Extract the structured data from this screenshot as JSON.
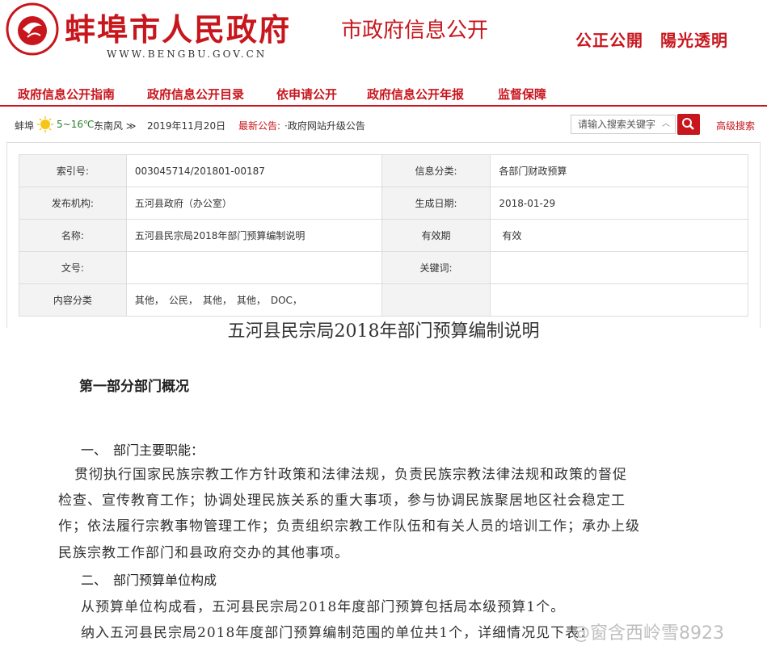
{
  "header": {
    "site_name": "蚌埠市人民政府",
    "site_url": "WWW.BENGBU.GOV.CN",
    "section_title": "市政府信息公开",
    "slogan": "公正公開　陽光透明",
    "logo_label": "中国蚌埠 BENGBU CHINA",
    "brand_color": "#c8161d"
  },
  "nav": {
    "items": [
      "政府信息公开指南",
      "政府信息公开目录",
      "依申请公开",
      "政府信息公开年报",
      "监督保障"
    ]
  },
  "info_bar": {
    "city": "蚌埠",
    "weather_icon": "sun-icon",
    "temperature": "5~16℃",
    "wind": "东南风 ≫",
    "date": "2019年11月20日",
    "latest_label": "最新公告:",
    "latest_text": "·政府网站升级公告",
    "search_placeholder": "请输入搜索关键字",
    "search_icon": "search-icon",
    "advanced_search": "高级搜索"
  },
  "meta": {
    "rows": [
      {
        "l1": "索引号:",
        "v1": "003045714/201801-00187",
        "l2": "信息分类:",
        "v2": "各部门财政预算"
      },
      {
        "l1": "发布机构:",
        "v1": "五河县政府（办公室）",
        "l2": "生成日期:",
        "v2": "2018-01-29"
      },
      {
        "l1": "名称:",
        "v1": "五河县民宗局2018年部门预算编制说明",
        "l2": "有效期",
        "v2": "有效"
      },
      {
        "l1": "文号:",
        "v1": "",
        "l2": "关键词:",
        "v2": ""
      },
      {
        "l1": "内容分类",
        "v1": "其他，　公民，　其他，　其他，　DOC，",
        "l2": "",
        "v2": ""
      }
    ]
  },
  "article": {
    "title": "五河县民宗局2018年部门预算编制说明",
    "part1_heading": "第一部分部门概况",
    "sub1": "一、　部门主要职能：",
    "para1_lines": [
      "贯彻执行国家民族宗教工作方针政策和法律法规，负责民族宗教法律法规和政策的督促",
      "检查、宣传教育工作；协调处理民族关系的重大事项，参与协调民族聚居地区社会稳定工",
      "作；依法履行宗教事物管理工作；负责组织宗教工作队伍和有关人员的培训工作；承办上级",
      "民族宗教工作部门和县政府交办的其他事项。"
    ],
    "sub2": "二、　部门预算单位构成",
    "para2_lines": [
      "从预算单位构成看，五河县民宗局2018年度部门预算包括局本级预算1个。",
      "纳入五河县民宗局2018年度部门预算编制范围的单位共1个，详细情况见下表："
    ]
  },
  "watermark": "@窗含西岭雪8923"
}
